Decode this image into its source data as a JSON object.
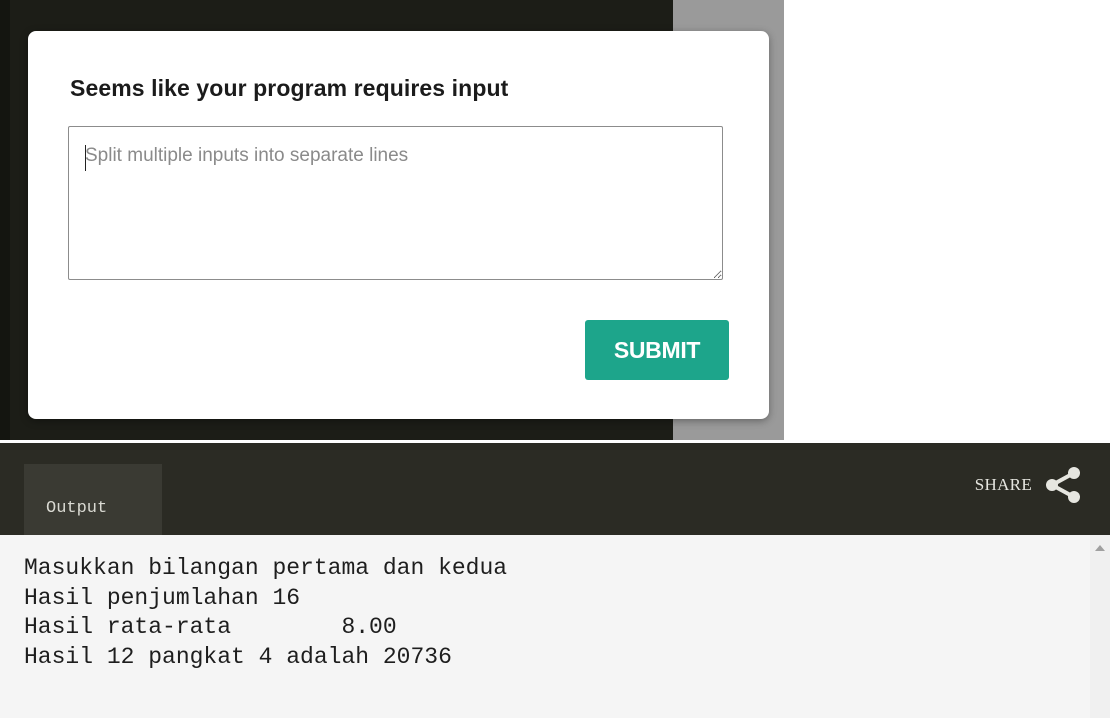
{
  "modal": {
    "title": "Seems like your program requires input",
    "input_placeholder": "Split multiple inputs into separate lines",
    "input_value": "",
    "submit_label": "SUBMIT"
  },
  "output_panel": {
    "tab_label": "Output",
    "share_label": "SHARE",
    "share_icon": "share-icon",
    "lines": [
      "Masukkan bilangan pertama dan kedua",
      "Hasil penjumlahan 16",
      "Hasil rata-rata        8.00",
      "Hasil 12 pangkat 4 adalah 20736"
    ]
  },
  "colors": {
    "accent": "#1da58b",
    "editor_background": "#1c1d17",
    "header_background": "#2b2b24",
    "output_background": "#f5f5f5"
  }
}
